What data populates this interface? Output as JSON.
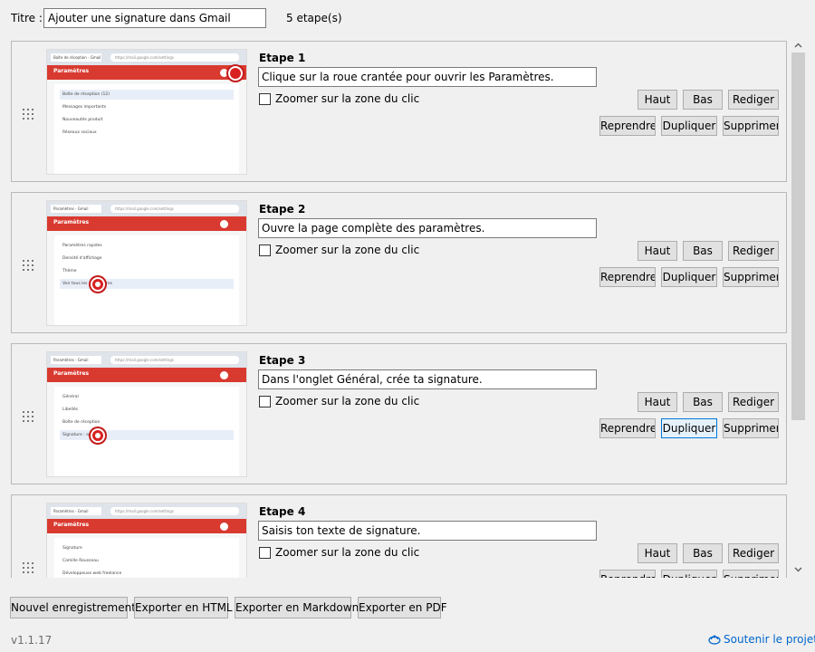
{
  "header": {
    "title_label": "Titre :",
    "title_value": "Ajouter une signature dans Gmail",
    "step_count": "5 etape(s)"
  },
  "common": {
    "zoom_label": "Zoomer sur la zone du clic",
    "btn_up": "Haut",
    "btn_down": "Bas",
    "btn_rewrite": "Rediger",
    "btn_retake": "Reprendre",
    "btn_duplicate": "Dupliquer",
    "btn_delete": "Supprimer"
  },
  "steps": [
    {
      "title": "Etape 1",
      "description": "Clique sur la roue crantée pour ouvrir les Paramètres.",
      "zoom": false,
      "thumb": {
        "tab": "Boîte de réception - Gmail",
        "url": "https://mail.google.com/settings",
        "header": "Paramètres",
        "items": [
          "Boîte de réception (12)",
          "Messages importants",
          "Nouveautés produit",
          "Réseaux sociaux"
        ],
        "highlight": 0
      }
    },
    {
      "title": "Etape 2",
      "description": "Ouvre la page complète des paramètres.",
      "zoom": false,
      "thumb": {
        "tab": "Paramètres - Gmail",
        "url": "https://mail.google.com/settings",
        "header": "Paramètres",
        "items": [
          "Paramètres rapides",
          "Densité d'affichage",
          "Thème",
          "Voir tous les paramètres"
        ],
        "highlight": 3
      }
    },
    {
      "title": "Etape 3",
      "description": "Dans l'onglet Général, crée ta signature.",
      "zoom": false,
      "thumb": {
        "tab": "Paramètres - Gmail",
        "url": "https://mail.google.com/settings",
        "header": "Paramètres",
        "items": [
          "Général",
          "Libellés",
          "Boîte de réception",
          "Signature : aucune"
        ],
        "highlight": 3
      }
    },
    {
      "title": "Etape 4",
      "description": "Saisis ton texte de signature.",
      "zoom": false,
      "thumb": {
        "tab": "Paramètres - Gmail",
        "url": "https://mail.google.com/settings",
        "header": "Paramètres",
        "items": [
          "Signature",
          "Camille Rousseau",
          "Développeuse web freelance",
          ""
        ],
        "highlight": -1
      }
    }
  ],
  "footer": {
    "btn_new": "Nouvel enregistrement",
    "btn_html": "Exporter en HTML",
    "btn_md": "Exporter en Markdown",
    "btn_pdf": "Exporter en PDF",
    "version": "v1.1.17",
    "support": "Soutenir le projet"
  },
  "icons": {
    "scroll_up": "chevron-up-icon",
    "scroll_down": "chevron-down-icon",
    "grip": "drag-handle-icon",
    "support": "donate-icon"
  },
  "colors": {
    "gmail_red": "#d93a30",
    "accent": "#0078d7",
    "link": "#0066cc"
  }
}
